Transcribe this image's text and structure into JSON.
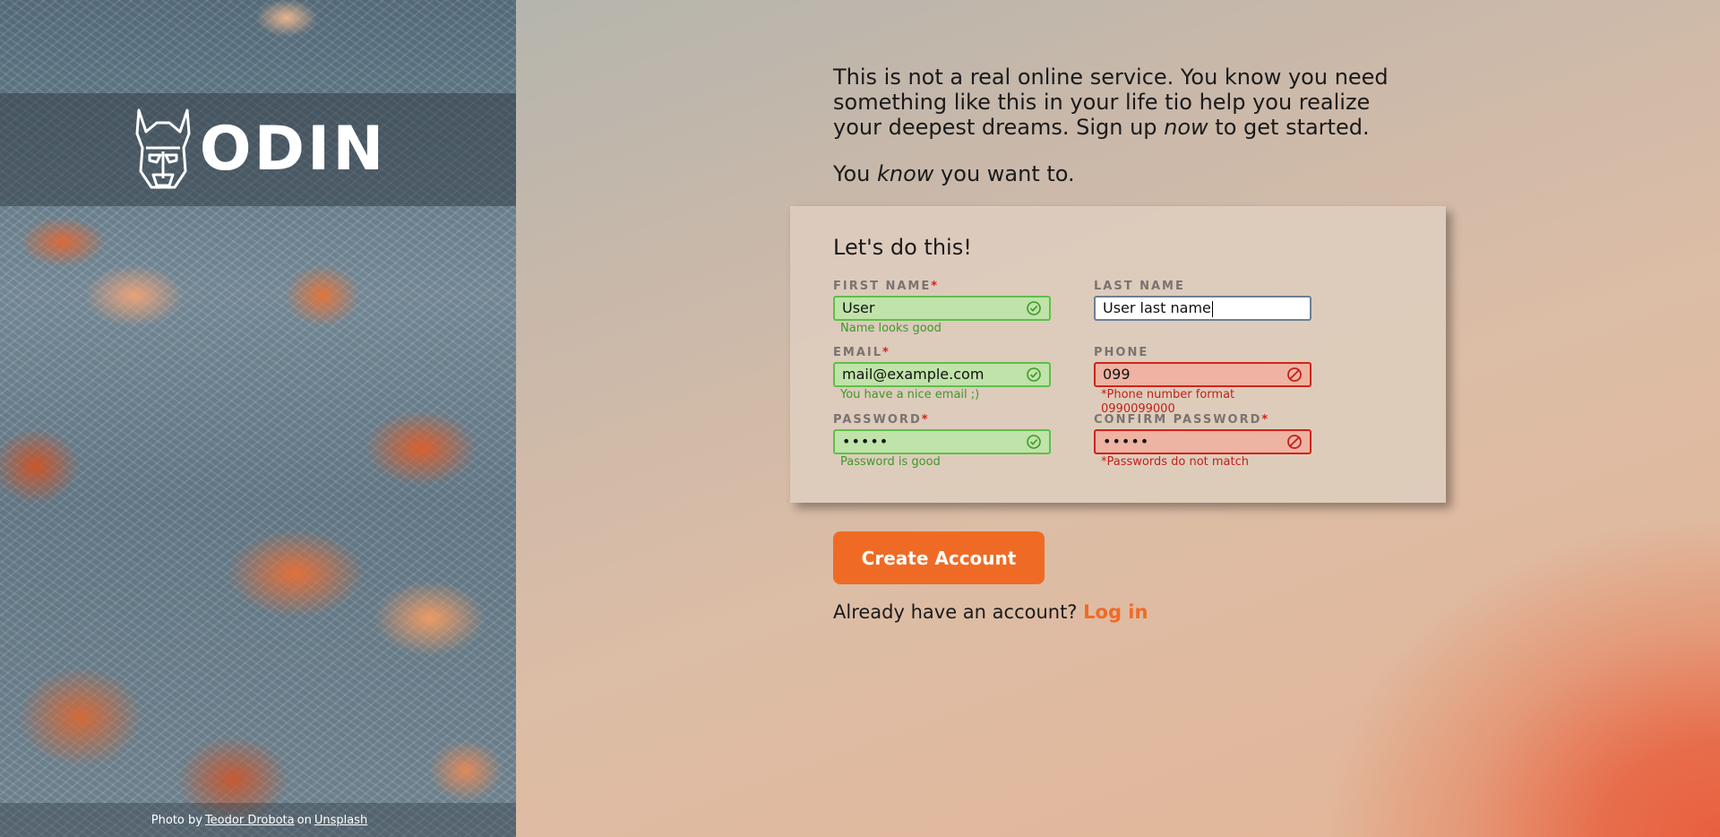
{
  "brand": {
    "logo_text": "ODIN",
    "logo_icon": "viking-helmet-icon"
  },
  "photo_credit": {
    "prefix": "Photo by",
    "author": "Teodor Drobota",
    "middle": "on",
    "site": "Unsplash"
  },
  "intro": {
    "p1_a": "This is not a real online service. You know you need something like this in your life tio help you realize your deepest dreams. Sign up ",
    "p1_em": "now",
    "p1_b": " to get started.",
    "p2_a": "You ",
    "p2_em": "know",
    "p2_b": " you want to."
  },
  "form": {
    "title": "Let's do this!",
    "required_mark": "*",
    "fields": {
      "first_name": {
        "label": "FIRST NAME",
        "value": "User",
        "status": "valid",
        "message": "Name looks good"
      },
      "last_name": {
        "label": "LAST NAME",
        "value": "User last name",
        "status": "focused",
        "message": ""
      },
      "email": {
        "label": "EMAIL",
        "value": "mail@example.com",
        "status": "valid",
        "message": "You have a nice email ;)"
      },
      "phone": {
        "label": "PHONE",
        "value": "099",
        "status": "invalid",
        "message": "*Phone number format 0990099000"
      },
      "password": {
        "label": "PASSWORD",
        "value": "•••••",
        "status": "valid",
        "message": "Password is good"
      },
      "confirm_password": {
        "label": "CONFIRM PASSWORD",
        "value": "•••••",
        "status": "invalid",
        "message": "*Passwords do not match"
      }
    }
  },
  "actions": {
    "create_account": "Create Account",
    "login_prompt": "Already have an account?",
    "login_link": "Log in"
  },
  "colors": {
    "accent": "#ef6b25",
    "valid_border": "#5fbf4a",
    "valid_bg": "#bfe3a9",
    "invalid_border": "#d0231c",
    "invalid_bg": "#eeb3a2"
  }
}
